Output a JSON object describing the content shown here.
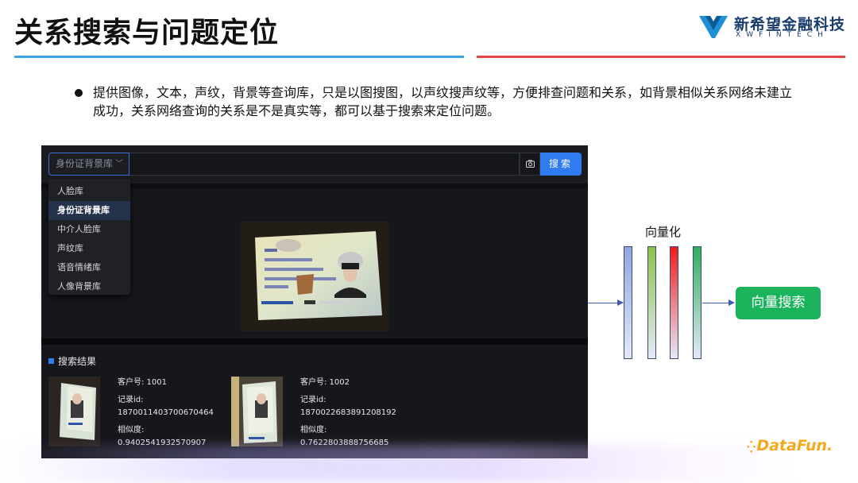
{
  "slide": {
    "title": "关系搜索与问题定位",
    "description": "提供图像，文本，声纹，背景等查询库，只是以图搜图，以声纹搜声纹等，方便排查问题和关系，如背景相似关系网络未建立成功，关系网络查询的关系是不是真实等，都可以基于搜索来定位问题。"
  },
  "logo": {
    "name_cn": "新希望金融科技",
    "name_en": "XWFINTECH",
    "mark_color": "#1f8fd6"
  },
  "app": {
    "library_select": {
      "value": "身份证背景库",
      "chevron": "chevron-down-icon"
    },
    "search_input": {
      "placeholder": ""
    },
    "camera_icon": "camera-icon",
    "search_button_label": "搜索",
    "dropdown": {
      "selected_index": 1,
      "options": [
        "人脸库",
        "身份证背景库",
        "中介人脸库",
        "声纹库",
        "语音情绪库",
        "人像背景库"
      ]
    },
    "results": {
      "title": "搜索结果",
      "items": [
        {
          "customer_label": "客户号: 1001",
          "record_label": "记录id:",
          "record_id": "1870011403700670464",
          "similarity_label": "相似度:",
          "similarity": "0.9402541932570907"
        },
        {
          "customer_label": "客户号: 1002",
          "record_label": "记录id:",
          "record_id": "1870022683891208192",
          "similarity_label": "相似度:",
          "similarity": "0.7622803888756685"
        }
      ]
    }
  },
  "diagram": {
    "vector_label": "向量化",
    "vector_bars": [
      {
        "top": "#8fa6e0",
        "bottom": "#e4e9f7"
      },
      {
        "top": "#8cc24a",
        "bottom": "#e4e9f7"
      },
      {
        "top": "#ee1c1c",
        "bottom": "#e4e9f7"
      },
      {
        "top": "#2fae5a",
        "bottom": "#e4e9f7"
      }
    ],
    "vector_search_label": "向量搜索",
    "accent": "#1bb35c"
  },
  "brand": {
    "name": "DataFun.",
    "color": "#f4a81c"
  }
}
